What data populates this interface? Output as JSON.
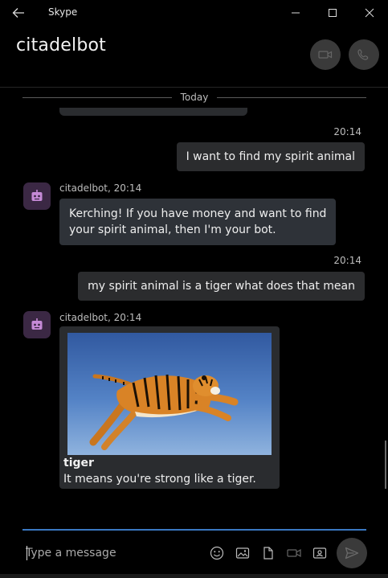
{
  "window": {
    "title": "Skype"
  },
  "header": {
    "contact_name": "citadelbot"
  },
  "chat": {
    "day_label": "Today",
    "messages": [
      {
        "time": "20:14",
        "text": "I want to find my spirit animal"
      },
      {
        "sender": "citadelbot, 20:14",
        "lines": [
          "Kerching! If you have money and want to find",
          "your spirit animal, then I'm your bot."
        ]
      },
      {
        "time": "20:14",
        "text": "my spirit animal is a tiger what does that mean"
      },
      {
        "sender": "citadelbot, 20:14",
        "card": {
          "title": "tiger",
          "text": "It means you're strong like a tiger."
        }
      }
    ]
  },
  "compose": {
    "placeholder": "Type a message"
  },
  "colors": {
    "background": "#000000",
    "bubble": "#2b2c2e",
    "accent": "#3a78c2",
    "avatar": "#3b2844",
    "avatar_icon": "#c58ad6"
  },
  "icons": [
    "back-arrow-icon",
    "minimize-icon",
    "maximize-icon",
    "close-icon",
    "video-call-icon",
    "phone-icon",
    "bot-icon",
    "emoji-icon",
    "image-icon",
    "file-icon",
    "video-message-icon",
    "contact-card-icon",
    "send-icon"
  ]
}
